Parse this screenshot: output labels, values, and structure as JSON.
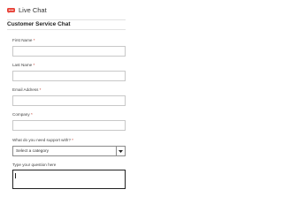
{
  "header": {
    "title": "Live Chat",
    "logo_icon": "chat-bubble-icon",
    "brand_color": "#e8443a"
  },
  "section": {
    "title": "Customer Service Chat"
  },
  "form": {
    "required_marker": "*",
    "first_name": {
      "label": "First Name",
      "value": ""
    },
    "last_name": {
      "label": "Last Name",
      "value": ""
    },
    "email": {
      "label": "Email Address",
      "value": ""
    },
    "company": {
      "label": "Company",
      "value": ""
    },
    "support_topic": {
      "label": "What do you need support with?",
      "selected": "Select a category",
      "arrow_icon": "caret-down-icon"
    },
    "question": {
      "label": "Type your question here",
      "value": ""
    }
  }
}
